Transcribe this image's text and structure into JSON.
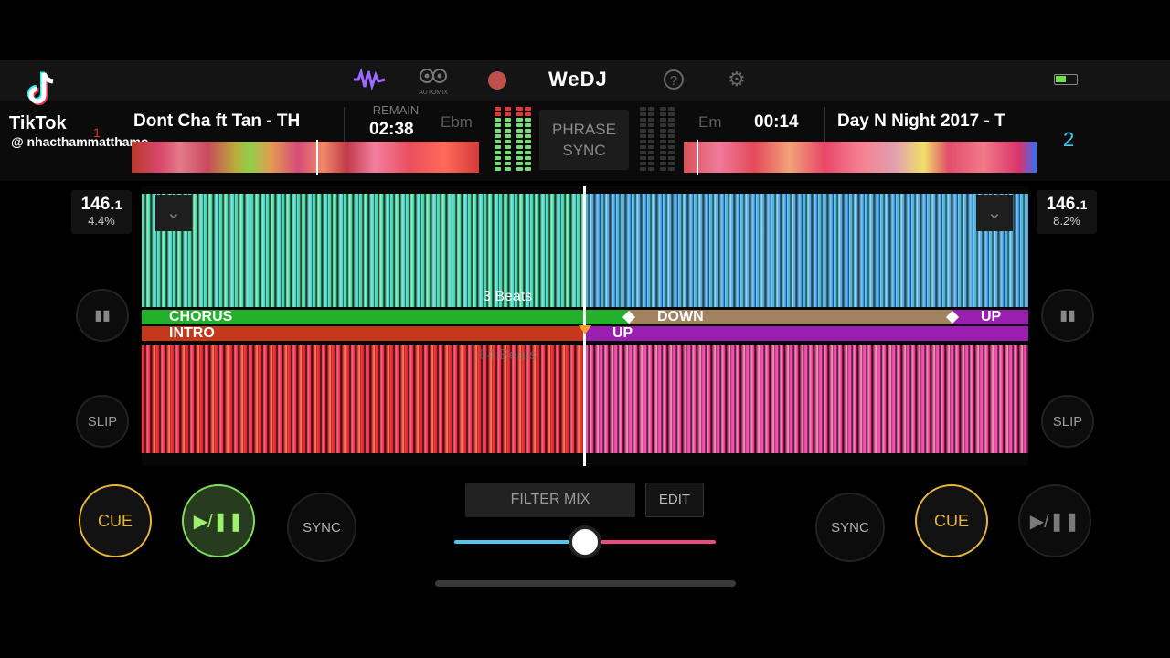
{
  "overlay": {
    "brand": "TikTok",
    "handle": "@ nhacthammatthamo"
  },
  "topbar": {
    "app_title": "WeDJ",
    "icons": [
      "waveform-icon",
      "automix-icon",
      "record-icon",
      "help-icon",
      "gear-icon",
      "battery-icon"
    ],
    "automix_label": "AUTOMIX",
    "accent_color": "#9b6cff"
  },
  "deck1": {
    "title": "Dont Cha ft Tan - TH",
    "number": "1",
    "remain_label": "REMAIN",
    "time": "02:38",
    "key": "Ebm",
    "bpm_main": "146.",
    "bpm_decimal": "1",
    "pitch": "4.4%",
    "cue_label": "CUE",
    "play_label": "▶/❚❚",
    "sync_label": "SYNC",
    "slip_label": "SLIP",
    "phrases": {
      "top": "CHORUS",
      "bottom": "INTRO"
    },
    "beats_label": "64 Beats",
    "color": "#e33320"
  },
  "deck2": {
    "title": "Day N Night 2017 - T",
    "number": "2",
    "time": "00:14",
    "key": "Em",
    "bpm_main": "146.",
    "bpm_decimal": "1",
    "pitch": "8.2%",
    "cue_label": "CUE",
    "play_label": "▶/❚❚",
    "sync_label": "SYNC",
    "slip_label": "SLIP",
    "phrases": {
      "down": "DOWN",
      "up": "UP",
      "up2": "UP"
    },
    "beats_label": "3 Beats",
    "color": "#35c9f5"
  },
  "center": {
    "phrase_sync": [
      "PHRASE",
      "SYNC"
    ],
    "filter_mix": "FILTER MIX",
    "edit": "EDIT",
    "crossfader_position": 0.5,
    "crossfader_colors": [
      "#4fc8ef",
      "#f04a7c"
    ]
  }
}
